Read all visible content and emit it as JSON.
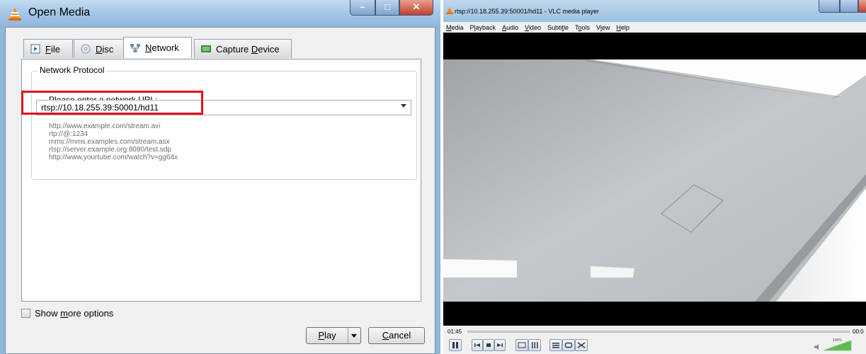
{
  "dialog": {
    "title": "Open Media",
    "tabs": [
      {
        "label_mnemonic": "F",
        "label_rest": "ile",
        "icon": "file-icon"
      },
      {
        "label_mnemonic": "D",
        "label_rest": "isc",
        "icon": "disc-icon"
      },
      {
        "label_mnemonic": "N",
        "label_rest": "etwork",
        "icon": "network-icon"
      },
      {
        "label_pre": "Capture ",
        "label_mnemonic": "D",
        "label_rest": "evice",
        "icon": "capture-device-icon"
      }
    ],
    "active_tab": "Network",
    "group_title": "Network Protocol",
    "url_prompt": "Please enter a network URL:",
    "url_value": "rtsp://10.18.255.39:50001/hd11",
    "examples": [
      "http://www.example.com/stream.avi",
      "rtp://@:1234",
      "mms://mms.examples.com/stream.asx",
      "rtsp://server.example.org:8080/test.sdp",
      "http://www.yourtube.com/watch?v=gg64x"
    ],
    "show_more": {
      "pre": "Show ",
      "mnemonic": "m",
      "rest": "ore options"
    },
    "play": {
      "mnemonic": "P",
      "rest": "lay"
    },
    "cancel": {
      "mnemonic": "C",
      "rest": "ancel"
    },
    "highlight_color": "#e0121e"
  },
  "vlc": {
    "title": "rtsp://10.18.255.39:50001/hd11 - VLC media player",
    "menu": [
      {
        "mnemonic": "M",
        "rest": "edia"
      },
      {
        "pre": "P",
        "mnemonic": "l",
        "rest": "ayback"
      },
      {
        "mnemonic": "A",
        "rest": "udio"
      },
      {
        "mnemonic": "V",
        "rest": "ideo"
      },
      {
        "pre": "Subti",
        "mnemonic": "t",
        "rest": "le"
      },
      {
        "pre": "T",
        "mnemonic": "o",
        "rest": "ols"
      },
      {
        "pre": "V",
        "mnemonic": "i",
        "rest": "ew"
      },
      {
        "mnemonic": "H",
        "rest": "elp"
      }
    ],
    "time_elapsed": "01:45",
    "time_total": "00:0",
    "volume": "100%"
  }
}
